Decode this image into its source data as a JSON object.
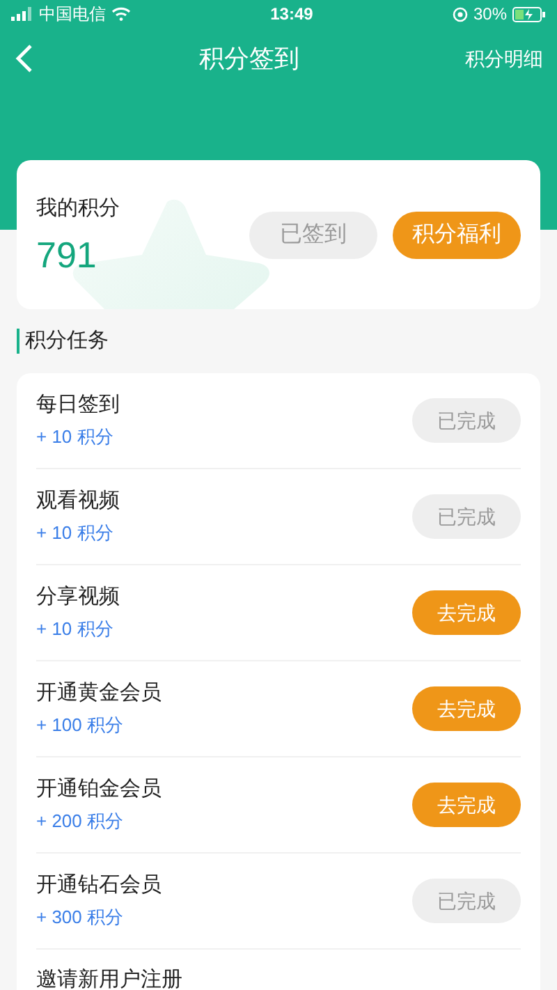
{
  "status_bar": {
    "carrier": "中国电信",
    "time": "13:49",
    "battery": "30%"
  },
  "nav": {
    "title": "积分签到",
    "action": "积分明细"
  },
  "points_card": {
    "label": "我的积分",
    "value": "791",
    "buttons": [
      {
        "label": "已签到",
        "disabled": true
      },
      {
        "label": "积分福利",
        "disabled": false
      }
    ]
  },
  "section_title": "积分任务",
  "tasks": [
    {
      "title": "每日签到",
      "points": "+ 10 积分",
      "button": {
        "label": "已完成",
        "done": true
      }
    },
    {
      "title": "观看视频",
      "points": "+ 10 积分",
      "button": {
        "label": "已完成",
        "done": true
      }
    },
    {
      "title": "分享视频",
      "points": "+ 10 积分",
      "button": {
        "label": "去完成",
        "done": false
      }
    },
    {
      "title": "开通黄金会员",
      "points": "+ 100 积分",
      "button": {
        "label": "去完成",
        "done": false
      }
    },
    {
      "title": "开通铂金会员",
      "points": "+ 200 积分",
      "button": {
        "label": "去完成",
        "done": false
      }
    },
    {
      "title": "开通钻石会员",
      "points": "+ 300 积分",
      "button": {
        "label": "已完成",
        "done": true
      }
    },
    {
      "title": "邀请新用户注册"
    }
  ]
}
